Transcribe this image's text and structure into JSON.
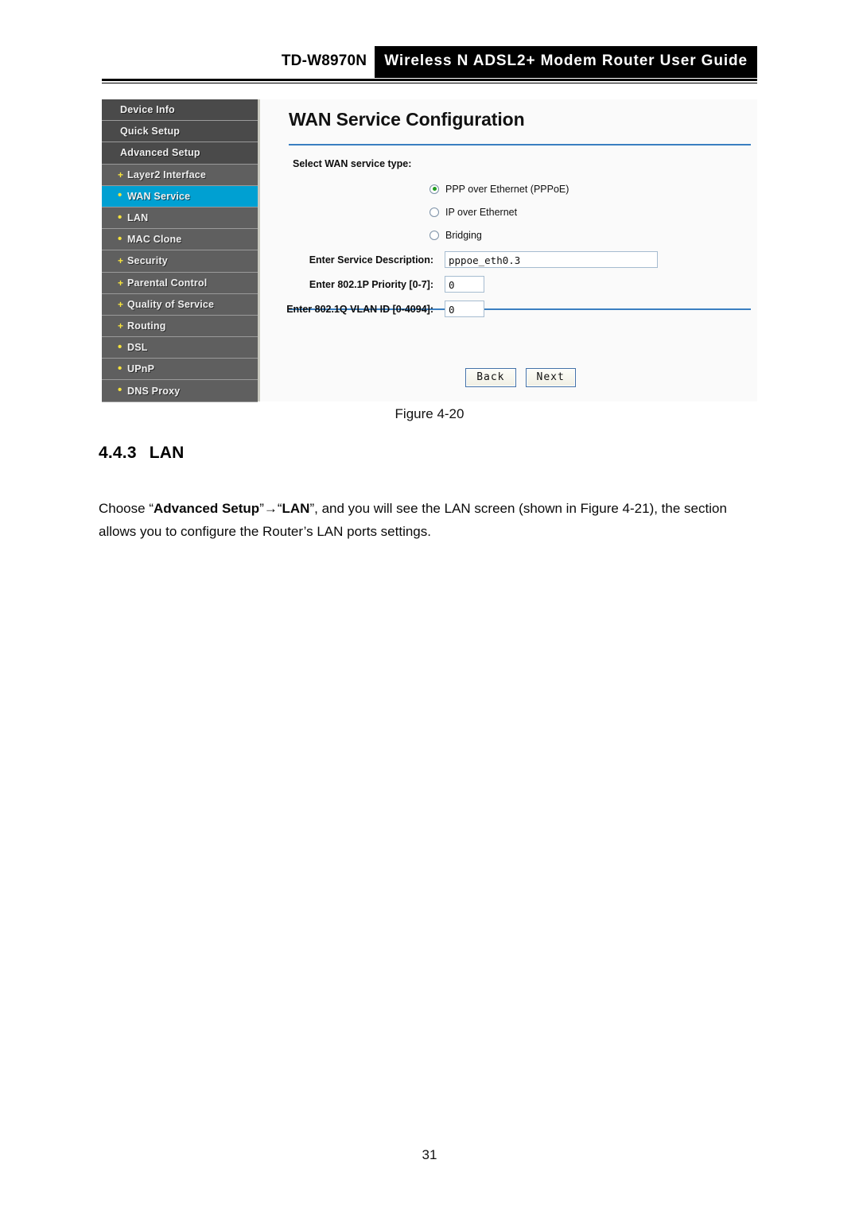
{
  "header": {
    "model": "TD-W8970N",
    "band_title": "Wireless N ADSL2+ Modem Router User Guide"
  },
  "router_ui": {
    "sidebar": {
      "items": [
        {
          "label": "Device Info",
          "marker": "",
          "level": "top",
          "selected": false
        },
        {
          "label": "Quick Setup",
          "marker": "",
          "level": "top",
          "selected": false
        },
        {
          "label": "Advanced Setup",
          "marker": "",
          "level": "top",
          "selected": false
        },
        {
          "label": "Layer2 Interface",
          "marker": "+",
          "level": "sub",
          "selected": false
        },
        {
          "label": "WAN Service",
          "marker": "•",
          "level": "sub",
          "selected": true
        },
        {
          "label": "LAN",
          "marker": "•",
          "level": "sub",
          "selected": false
        },
        {
          "label": "MAC Clone",
          "marker": "•",
          "level": "sub",
          "selected": false
        },
        {
          "label": "Security",
          "marker": "+",
          "level": "sub",
          "selected": false
        },
        {
          "label": "Parental Control",
          "marker": "+",
          "level": "sub",
          "selected": false
        },
        {
          "label": "Quality of Service",
          "marker": "+",
          "level": "sub",
          "selected": false
        },
        {
          "label": "Routing",
          "marker": "+",
          "level": "sub",
          "selected": false
        },
        {
          "label": "DSL",
          "marker": "•",
          "level": "sub",
          "selected": false
        },
        {
          "label": "UPnP",
          "marker": "•",
          "level": "sub",
          "selected": false
        },
        {
          "label": "DNS Proxy",
          "marker": "•",
          "level": "sub",
          "selected": false
        }
      ],
      "selected_color": "#00a0d2",
      "marker_color": "#f5e23c"
    },
    "panel": {
      "title": "WAN Service Configuration",
      "rule_color": "#3a7fc1",
      "select_type_label": "Select WAN service type:",
      "radio_options": [
        {
          "label": "PPP over Ethernet (PPPoE)",
          "checked": true
        },
        {
          "label": "IP over Ethernet",
          "checked": false
        },
        {
          "label": "Bridging",
          "checked": false
        }
      ],
      "fields": [
        {
          "label": "Enter Service Description:",
          "value": "pppoe_eth0.3",
          "size": "wide"
        },
        {
          "label": "Enter 802.1P Priority [0-7]:",
          "value": "0",
          "size": "narrow"
        },
        {
          "label": "Enter 802.1Q VLAN ID [0-4094]:",
          "value": "0",
          "size": "narrow"
        }
      ],
      "buttons": [
        {
          "label": "Back"
        },
        {
          "label": "Next"
        }
      ]
    }
  },
  "document": {
    "figure_caption": "Figure 4-20",
    "section_number": "4.4.3",
    "section_title": "LAN",
    "paragraph": {
      "part1": "Choose “",
      "bold1": "Advanced Setup",
      "part2": "”→“",
      "bold2": "LAN",
      "part3": "”, and you will see the LAN screen (shown in Figure 4-21), the section allows you to configure the Router’s LAN ports settings."
    },
    "page_number": "31"
  }
}
